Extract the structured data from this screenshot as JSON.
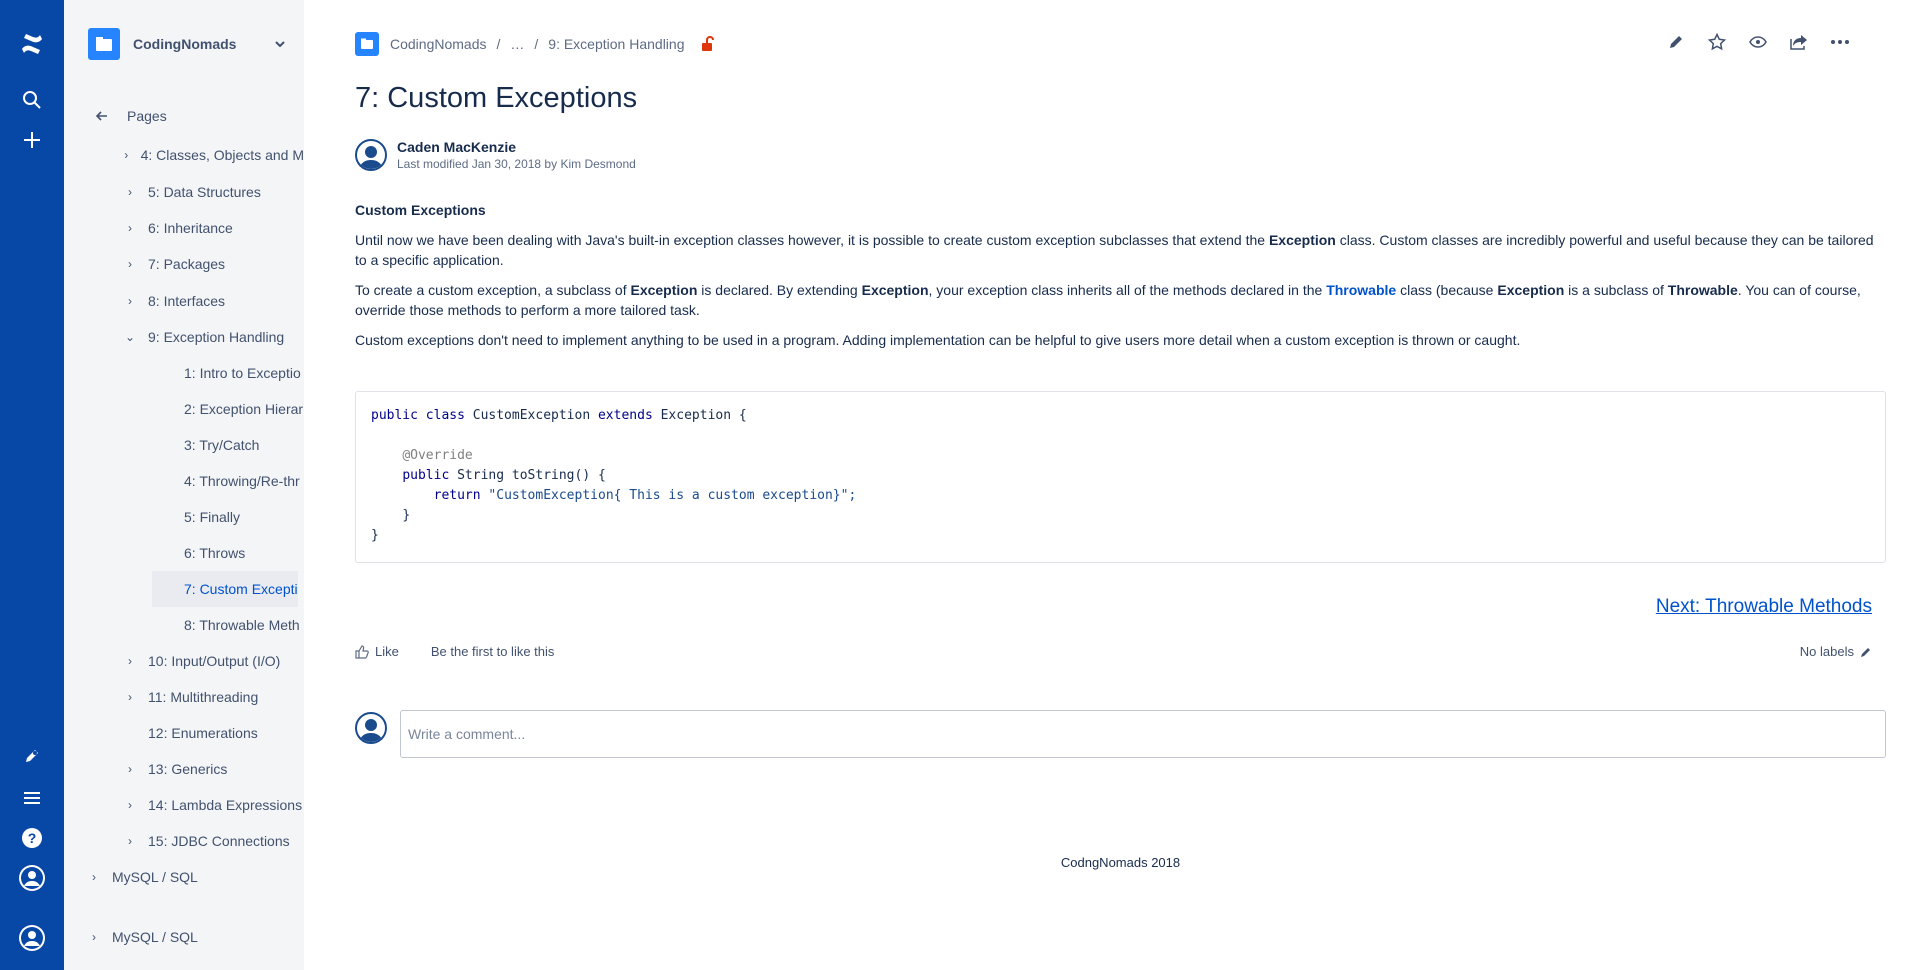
{
  "global_nav": {
    "icons": [
      "confluence-logo-icon",
      "search-icon",
      "create-icon",
      "feedback-icon",
      "menu-icon",
      "help-icon",
      "profile-icon",
      "user-icon"
    ]
  },
  "sidebar": {
    "space_name": "CodingNomads",
    "pages_label": "Pages",
    "tree": [
      {
        "label": "4: Classes, Objects and M",
        "twisty": "›"
      },
      {
        "label": "5: Data Structures",
        "twisty": "›"
      },
      {
        "label": "6: Inheritance",
        "twisty": "›"
      },
      {
        "label": "7: Packages",
        "twisty": "›"
      },
      {
        "label": "8: Interfaces",
        "twisty": "›"
      },
      {
        "label": "9: Exception Handling",
        "twisty": "⌄"
      },
      {
        "label": "1: Intro to Exceptio",
        "twisty": ""
      },
      {
        "label": "2: Exception Hierar",
        "twisty": ""
      },
      {
        "label": "3: Try/Catch",
        "twisty": ""
      },
      {
        "label": "4: Throwing/Re-thr",
        "twisty": ""
      },
      {
        "label": "5: Finally",
        "twisty": ""
      },
      {
        "label": "6: Throws",
        "twisty": ""
      },
      {
        "label": "7: Custom Exceptio",
        "twisty": ""
      },
      {
        "label": "8: Throwable Meth",
        "twisty": ""
      },
      {
        "label": "10: Input/Output (I/O)",
        "twisty": "›"
      },
      {
        "label": "11: Multithreading",
        "twisty": "›"
      },
      {
        "label": "12: Enumerations",
        "twisty": ""
      },
      {
        "label": "13: Generics",
        "twisty": "›"
      },
      {
        "label": "14: Lambda Expressions",
        "twisty": "›"
      },
      {
        "label": "15: JDBC Connections",
        "twisty": "›"
      },
      {
        "label": "MySQL / SQL",
        "twisty": "›"
      },
      {
        "label": "MySQL / SQL",
        "twisty": "›"
      }
    ]
  },
  "breadcrumb": {
    "space": "CodingNomads",
    "ellipsis": "…",
    "parent": "9: Exception Handling",
    "sep": "/"
  },
  "page": {
    "title": "7: Custom Exceptions",
    "author": "Caden MacKenzie",
    "modified": "Last modified Jan 30, 2018 by Kim Desmond"
  },
  "content": {
    "heading": "Custom Exceptions",
    "p1_a": "Until now we have been dealing with Java's built-in exception classes however, it is possible to create custom exception subclasses that extend the ",
    "p1_b": "Exception",
    "p1_c": " class. Custom classes are incredibly powerful and useful because they can be tailored to a specific application.",
    "p2_a": "To create a custom exception, a subclass of ",
    "p2_b": "Exception",
    "p2_c": " is declared. By extending ",
    "p2_d": "Exception",
    "p2_e": ", your exception class inherits all of the methods declared in the ",
    "p2_f": "Throwable",
    "p2_g": " class (because ",
    "p2_h": "Exception",
    "p2_i": " is a subclass of ",
    "p2_j": "Throwable",
    "p2_k": ". You can of course, override those methods to perform a more tailored task.",
    "p3": "Custom exceptions don't need to implement anything to be used in a program. Adding implementation can be helpful to give users more detail when a custom exception is thrown or caught."
  },
  "code": {
    "l1_kw": "public class",
    "l1_name": " CustomException ",
    "l1_kw2": "extends",
    "l1_rest": " Exception {",
    "l3": "@Override",
    "l4_kw": "public",
    "l4_rest": " String toString() {",
    "l5_kw": "return",
    "l5_str": " \"CustomException{ This is a custom exception}\";",
    "l6": "}",
    "l7": "}"
  },
  "next_link": "Next: Throwable Methods",
  "like": {
    "label": "Like",
    "first": "Be the first to like this"
  },
  "labels": "No labels",
  "comment": {
    "placeholder": "Write a comment..."
  },
  "footer": "CodngNomads 2018",
  "colors": {
    "global_nav": "#0747a6",
    "sidebar": "#f4f5f7",
    "link": "#0052cc",
    "lock": "#de350b"
  }
}
